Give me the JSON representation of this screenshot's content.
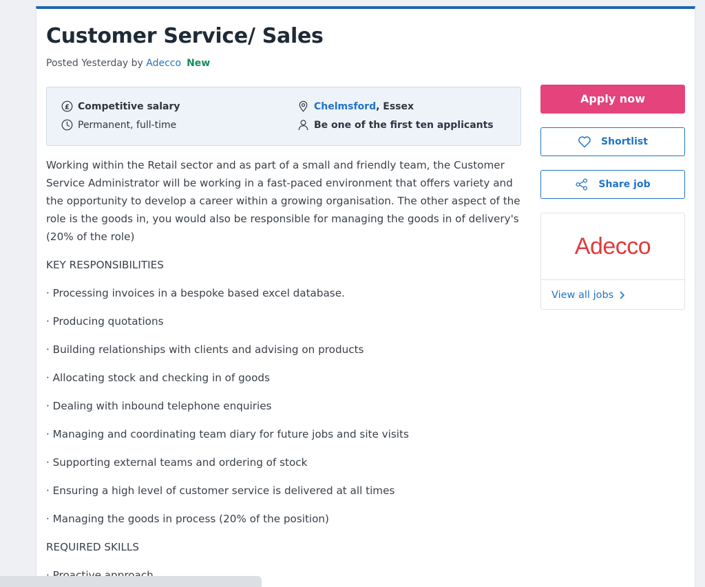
{
  "job": {
    "title": "Customer Service/ Sales",
    "posted_prefix": "Posted Yesterday by ",
    "company": "Adecco",
    "badge": "New"
  },
  "summary": {
    "salary": "Competitive salary",
    "type": "Permanent, full-time",
    "location_city": "Chelmsford",
    "location_region": ", Essex",
    "applicants": "Be one of the first ten applicants"
  },
  "description": {
    "intro": "Working within the Retail sector and as part of a small and friendly team, the Customer Service Administrator will be working in a fast-paced environment that offers variety and the opportunity to develop a career within a growing organisation. The other aspect of the role is the goods in, you would also be responsible for managing the goods in of delivery's (20% of the role)",
    "key_heading": "KEY RESPONSIBILITIES",
    "responsibilities": [
      "· Processing invoices in a bespoke based excel database.",
      "· Producing quotations",
      "· Building relationships with clients and advising on products",
      "· Allocating stock and checking in of goods",
      "· Dealing with inbound telephone enquiries",
      "· Managing and coordinating team diary for future jobs and site visits",
      "· Supporting external teams and ordering of stock",
      "· Ensuring a high level of customer service is delivered at all times",
      "· Managing the goods in process (20% of the position)"
    ],
    "skills_heading": "REQUIRED SKILLS",
    "skills": [
      "· Proactive approach"
    ]
  },
  "sidebar": {
    "apply_label": "Apply now",
    "shortlist_label": "Shortlist",
    "share_label": "Share job",
    "company_logo_text": "Adecco",
    "view_all_label": "View all jobs"
  },
  "icons": {
    "salary": "pound-icon",
    "type": "clock-icon",
    "location": "map-pin-icon",
    "applicants": "person-icon",
    "shortlist": "heart-icon",
    "share": "share-icon",
    "view_all": "chevron-right-icon"
  },
  "colors": {
    "accent_blue": "#1f73c4",
    "top_bar": "#1f66b3",
    "apply_pink": "#e4437c",
    "new_green": "#168a5a",
    "logo_red": "#e03a3e"
  }
}
